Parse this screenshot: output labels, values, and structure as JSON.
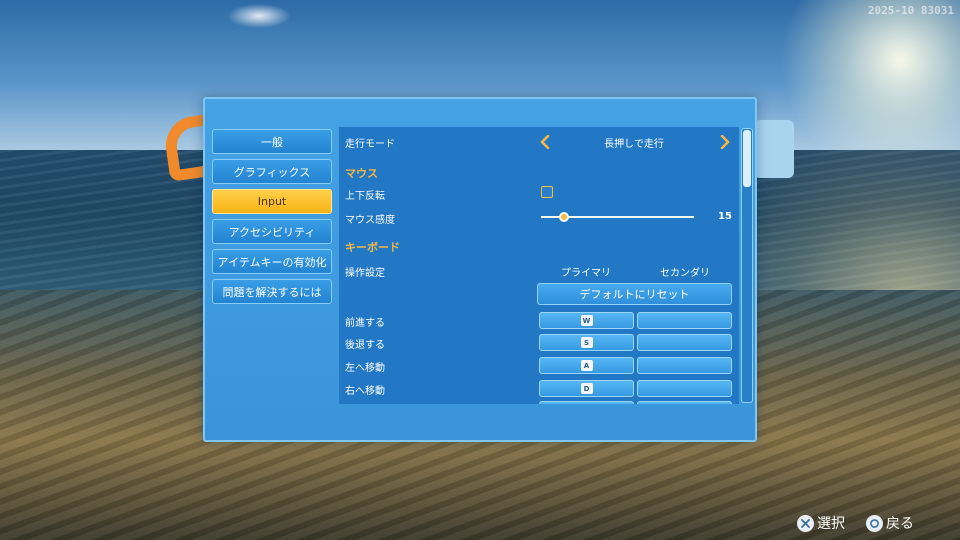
{
  "status": {
    "uid": "2025-10 83031"
  },
  "nav": {
    "items": [
      {
        "label": "一般",
        "active": false
      },
      {
        "label": "グラフィックス",
        "active": false
      },
      {
        "label": "Input",
        "active": true
      },
      {
        "label": "アクセシビリティ",
        "active": false
      },
      {
        "label": "アイテムキーの有効化",
        "active": false
      },
      {
        "label": "問題を解決するには",
        "active": false
      }
    ]
  },
  "settings": {
    "run_mode": {
      "label": "走行モード",
      "value": "長押しで走行"
    },
    "mouse_section": "マウス",
    "invert_y": {
      "label": "上下反転",
      "checked": false
    },
    "mouse_sensitivity": {
      "label": "マウス感度",
      "value": "15",
      "level": 0.15
    },
    "keyboard_section": "キーボード",
    "controls": {
      "label": "操作設定",
      "primary_header": "プライマリ",
      "secondary_header": "セカンダリ",
      "reset_label": "デフォルトにリセット"
    },
    "bindings": [
      {
        "label": "前進する",
        "primary": "W",
        "secondary": ""
      },
      {
        "label": "後退する",
        "primary": "S",
        "secondary": ""
      },
      {
        "label": "左へ移動",
        "primary": "A",
        "secondary": ""
      },
      {
        "label": "右へ移動",
        "primary": "D",
        "secondary": ""
      }
    ]
  },
  "footer": {
    "select_label": "選択",
    "back_label": "戻る"
  },
  "colors": {
    "panel": "#3a94da",
    "content": "#2278c4",
    "accent": "#f6b743",
    "active_tab": "#ffc52e"
  }
}
